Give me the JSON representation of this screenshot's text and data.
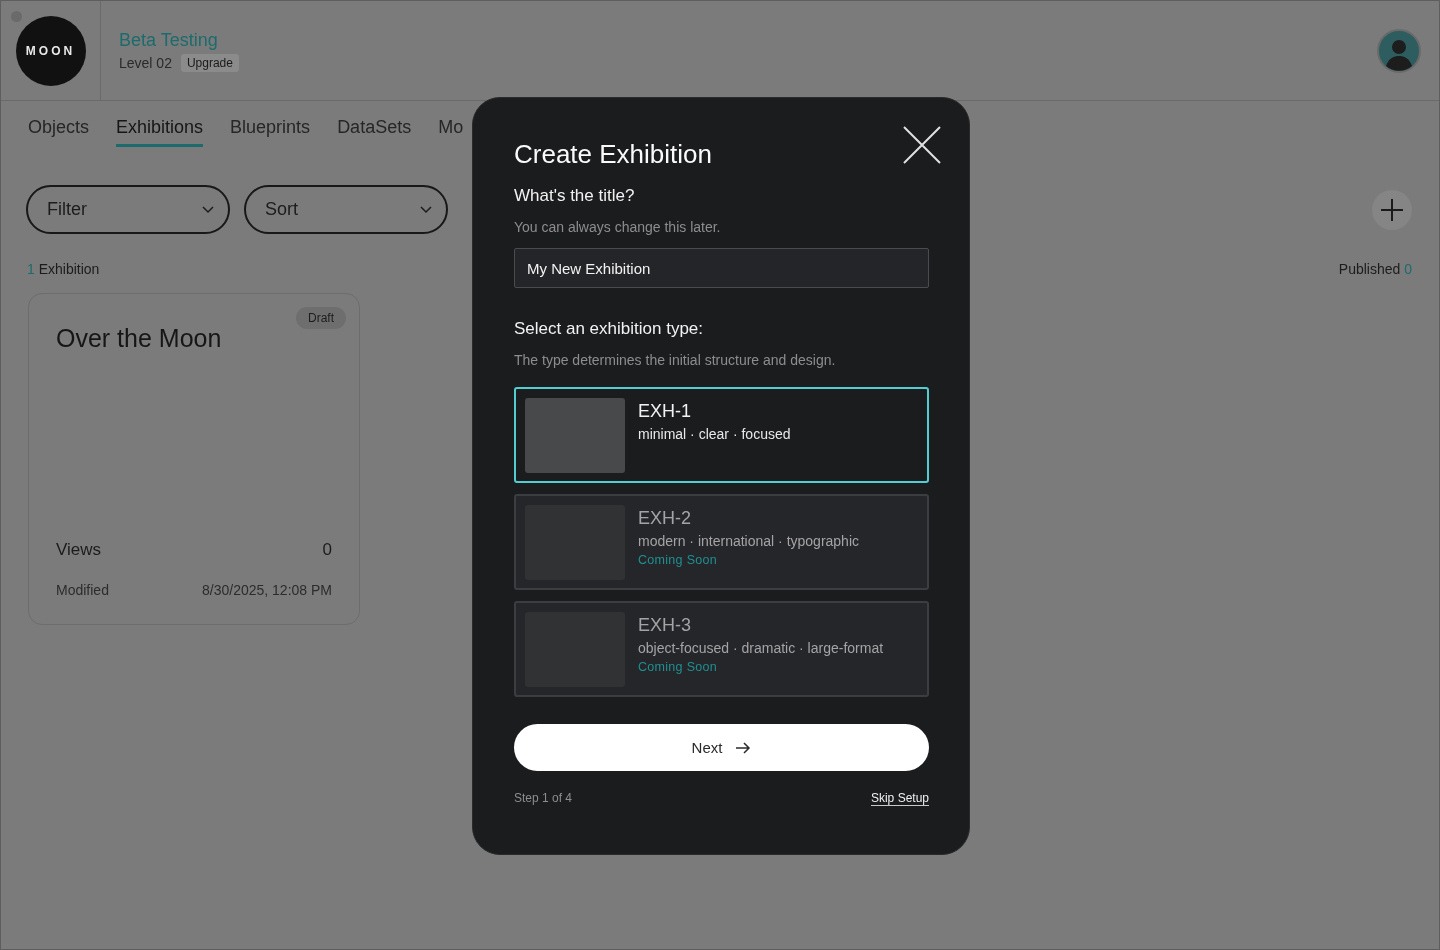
{
  "header": {
    "logo": "MOON",
    "workspace": "Beta Testing",
    "level": "Level 02",
    "upgrade": "Upgrade"
  },
  "tabs": [
    {
      "label": "Objects",
      "selected": false
    },
    {
      "label": "Exhibitions",
      "selected": true
    },
    {
      "label": "Blueprints",
      "selected": false
    },
    {
      "label": "DataSets",
      "selected": false
    },
    {
      "label": "Mo",
      "selected": false
    }
  ],
  "filters": [
    {
      "label": "Filter"
    },
    {
      "label": "Sort"
    }
  ],
  "counts": {
    "exhibitions_count": "1",
    "exhibitions_label": "Exhibition",
    "published_label": "Published",
    "published_count": "0"
  },
  "cards": [
    {
      "title": "Over the Moon",
      "status": "Draft",
      "views_label": "Views",
      "views": "0",
      "modified_label": "Modified",
      "modified": "8/30/2025, 12:08 PM"
    }
  ],
  "dialog": {
    "title": "Create Exhibition",
    "title_question": "What's the title?",
    "title_hint": "You can always change this later.",
    "title_value": "My New Exhibition",
    "type_question": "Select an exhibition type:",
    "type_hint": "The type determines the initial structure and design.",
    "types": [
      {
        "name": "EXH-1",
        "tags": "minimal · clear · focused",
        "selected": true,
        "disabled": false
      },
      {
        "name": "EXH-2",
        "tags": "modern · international · typographic",
        "note": "Coming Soon",
        "selected": false,
        "disabled": true
      },
      {
        "name": "EXH-3",
        "tags": "object-focused · dramatic · large-format",
        "note": "Coming Soon",
        "selected": false,
        "disabled": true
      }
    ],
    "next": "Next",
    "step": "Step 1 of 4",
    "skip": "Skip Setup"
  }
}
